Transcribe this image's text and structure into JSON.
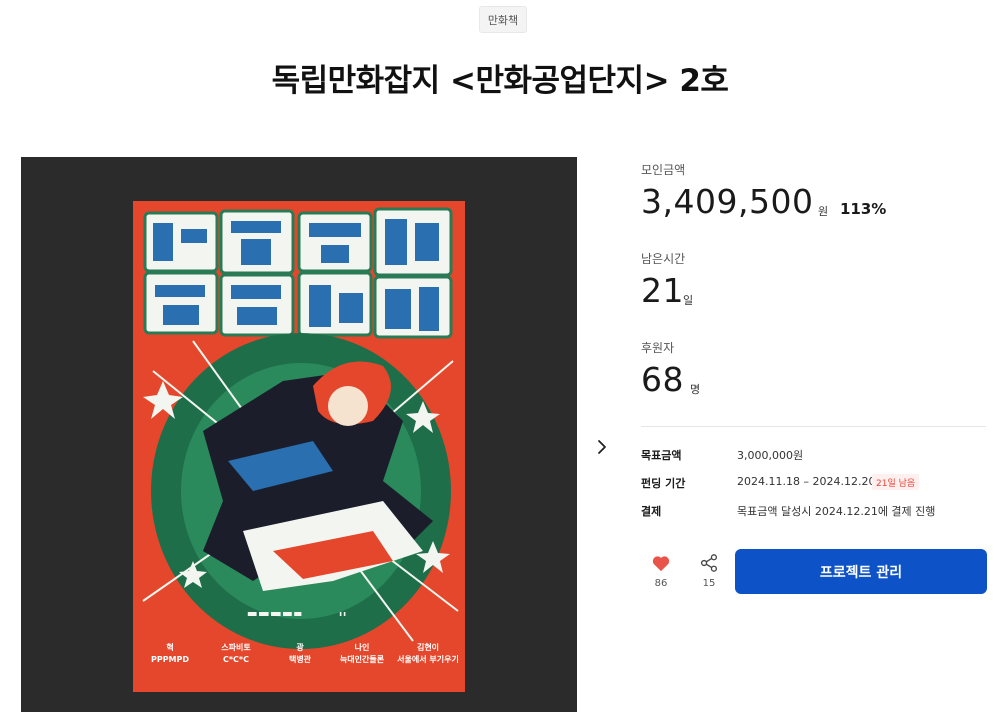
{
  "category": "만화책",
  "title": "독립만화잡지 <만화공업단지> 2호",
  "poster": {
    "credits": [
      {
        "top": "혁",
        "bottom": "PPPMPD"
      },
      {
        "top": "스파비토",
        "bottom": "C*C*C"
      },
      {
        "top": "광",
        "bottom": "택병관"
      },
      {
        "top": "나인",
        "bottom": "늑대인간들론"
      },
      {
        "top": "김현이",
        "bottom": "서울에서 부기우기"
      }
    ]
  },
  "stats": {
    "raised_label": "모인금액",
    "raised_value": "3,409,500",
    "raised_unit": "원",
    "raised_percent": "113%",
    "time_label": "남은시간",
    "time_value": "21",
    "time_unit": "일",
    "backers_label": "후원자",
    "backers_value": "68",
    "backers_unit": "명"
  },
  "info": {
    "goal_label": "목표금액",
    "goal_value": "3,000,000원",
    "period_label": "펀딩 기간",
    "period_value": "2024.11.18 – 2024.12.20",
    "days_left_badge": "21일 남음",
    "payment_label": "결제",
    "payment_value": "목표금액 달성시 2024.12.21에 결제 진행"
  },
  "actions": {
    "like_count": "86",
    "share_count": "15",
    "manage_label": "프로젝트 관리"
  },
  "colors": {
    "primary": "#0d52c7",
    "heart": "#e8544a",
    "poster_bg": "#e4472b",
    "badge_text": "#e8443a"
  }
}
